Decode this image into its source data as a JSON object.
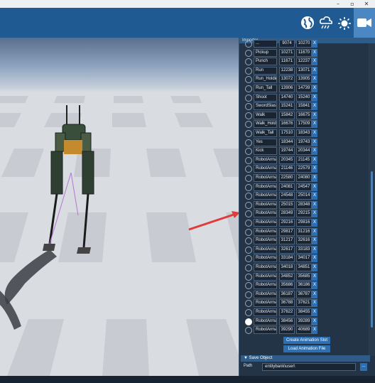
{
  "window": {
    "minimize": "–",
    "maximize": "▫",
    "close": "✕"
  },
  "toolbar": {
    "icons": [
      "globe-icon",
      "weather-icon",
      "sun-icon",
      "camera-icon"
    ]
  },
  "panel": {
    "title": "Importer",
    "animations": [
      {
        "name": "...",
        "start": "9074",
        "end": "10270",
        "selected": false
      },
      {
        "name": "Pickup",
        "start": "10271",
        "end": "11670",
        "selected": false
      },
      {
        "name": "Punch",
        "start": "11671",
        "end": "12237",
        "selected": false
      },
      {
        "name": "Run",
        "start": "12238",
        "end": "13071",
        "selected": false
      },
      {
        "name": "Run_Holdin",
        "start": "13072",
        "end": "13905",
        "selected": false
      },
      {
        "name": "Run_Tall",
        "start": "13906",
        "end": "14739",
        "selected": false
      },
      {
        "name": "Shoot",
        "start": "14740",
        "end": "15240",
        "selected": false
      },
      {
        "name": "SwordSlash",
        "start": "15241",
        "end": "15841",
        "selected": false
      },
      {
        "name": "Walk",
        "start": "15842",
        "end": "16675",
        "selected": false
      },
      {
        "name": "Walk_Holdi",
        "start": "16676",
        "end": "17509",
        "selected": false
      },
      {
        "name": "Walk_Tall",
        "start": "17510",
        "end": "18343",
        "selected": false
      },
      {
        "name": "Yes",
        "start": "18344",
        "end": "19743",
        "selected": false
      },
      {
        "name": "Kick",
        "start": "19744",
        "end": "20344",
        "selected": false
      },
      {
        "name": "RobotArma",
        "start": "20345",
        "end": "21145",
        "selected": false
      },
      {
        "name": "RobotArma",
        "start": "21146",
        "end": "22579",
        "selected": false
      },
      {
        "name": "RobotArma",
        "start": "22580",
        "end": "24080",
        "selected": false
      },
      {
        "name": "RobotArma",
        "start": "24081",
        "end": "24547",
        "selected": false
      },
      {
        "name": "RobotArma",
        "start": "24548",
        "end": "25014",
        "selected": false
      },
      {
        "name": "RobotArma",
        "start": "25015",
        "end": "28348",
        "selected": false
      },
      {
        "name": "RobotArma",
        "start": "28349",
        "end": "29215",
        "selected": false
      },
      {
        "name": "RobotArma",
        "start": "29216",
        "end": "29816",
        "selected": false
      },
      {
        "name": "RobotArma",
        "start": "29817",
        "end": "31216",
        "selected": false
      },
      {
        "name": "RobotArma",
        "start": "31217",
        "end": "32616",
        "selected": false
      },
      {
        "name": "RobotArma",
        "start": "32617",
        "end": "33183",
        "selected": false
      },
      {
        "name": "RobotArma",
        "start": "33184",
        "end": "34017",
        "selected": false
      },
      {
        "name": "RobotArma",
        "start": "34018",
        "end": "34851",
        "selected": false
      },
      {
        "name": "RobotArma",
        "start": "34852",
        "end": "35685",
        "selected": false
      },
      {
        "name": "RobotArma",
        "start": "35686",
        "end": "36186",
        "selected": false
      },
      {
        "name": "RobotArma",
        "start": "36187",
        "end": "36787",
        "selected": false
      },
      {
        "name": "RobotArma",
        "start": "36788",
        "end": "37621",
        "selected": false
      },
      {
        "name": "RobotArma",
        "start": "37622",
        "end": "38455",
        "selected": false
      },
      {
        "name": "RobotArma",
        "start": "38456",
        "end": "39289",
        "selected": true
      },
      {
        "name": "RobotArma",
        "start": "39290",
        "end": "40689",
        "selected": false
      }
    ],
    "remove_label": "X",
    "create_button": "Create Animation Slot",
    "load_button": "Load Animation File",
    "save_section": "▼  Save Object",
    "path_label": "Path",
    "path_value": "entitybank\\user\\",
    "browse_label": "..."
  },
  "colors": {
    "toolbar": "#1f5a92",
    "panel": "#243447",
    "accent": "#2d6fb0",
    "arrow": "#e03a3a"
  }
}
